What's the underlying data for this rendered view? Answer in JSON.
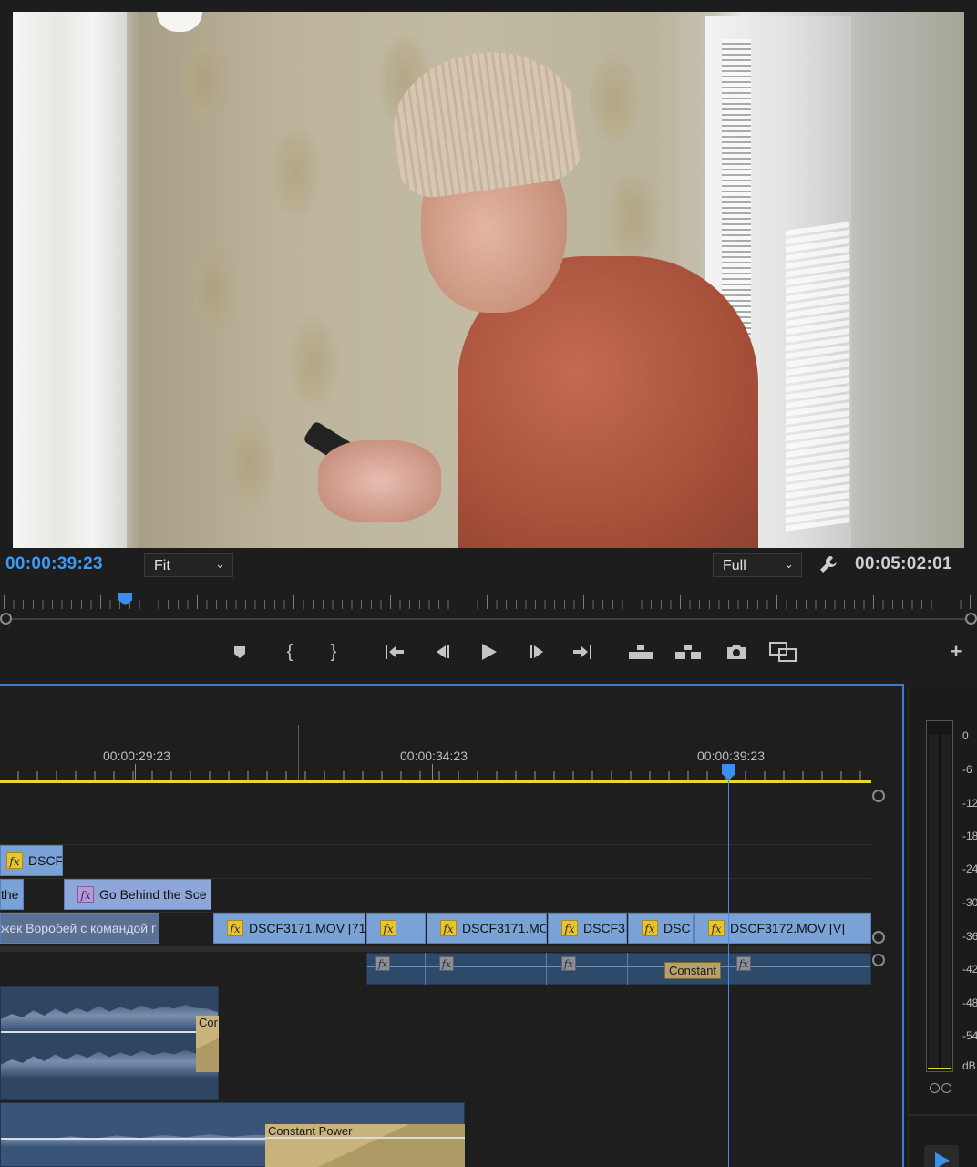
{
  "program_monitor": {
    "current_timecode": "00:00:39:23",
    "zoom_select": "Fit",
    "resolution_select": "Full",
    "duration_timecode": "00:05:02:01"
  },
  "transport": {
    "icons": [
      "marker-icon",
      "mark-in-icon",
      "mark-out-icon",
      "go-to-in-icon",
      "step-back-icon",
      "play-icon",
      "step-forward-icon",
      "go-to-out-icon",
      "lift-icon",
      "extract-icon",
      "export-frame-icon",
      "compare-view-icon",
      "add-button-icon"
    ]
  },
  "timeline": {
    "ruler_labels": [
      "00:00:29:23",
      "00:00:34:23",
      "00:00:39:23"
    ],
    "video_track_3": [
      {
        "label": "DSCF",
        "fx": "fx"
      }
    ],
    "video_track_2": [
      {
        "label": "the"
      },
      {
        "label": "Go Behind the Sce",
        "fx": "fx"
      }
    ],
    "video_track_1": [
      {
        "label": "жек Воробей с командой г"
      },
      {
        "label": "DSCF3171.MOV [71,",
        "fx": "fx"
      },
      {
        "label": "",
        "fx": "fx"
      },
      {
        "label": "DSCF3171.MO",
        "fx": "fx"
      },
      {
        "label": "DSCF3",
        "fx": "fx"
      },
      {
        "label": "DSC",
        "fx": "fx"
      },
      {
        "label": "DSCF3172.MOV [V]",
        "fx": "fx"
      }
    ],
    "audio_fx_badges": [
      "fx",
      "fx",
      "fx",
      "fx"
    ],
    "transitions": {
      "a1_tag": "Constant",
      "a2_partial": "Cor",
      "a3_label": "Constant Power"
    }
  },
  "audio_meter": {
    "scale": [
      "0",
      "-6",
      "-12",
      "-18",
      "-24",
      "-30",
      "-36",
      "-42",
      "-48",
      "-54",
      "dB"
    ],
    "colors": {
      "accent": "#3a8ef0",
      "work_area": "#e8d92a",
      "clip_video": "#7aa2d6",
      "fx_badge": "#e6c435"
    }
  }
}
